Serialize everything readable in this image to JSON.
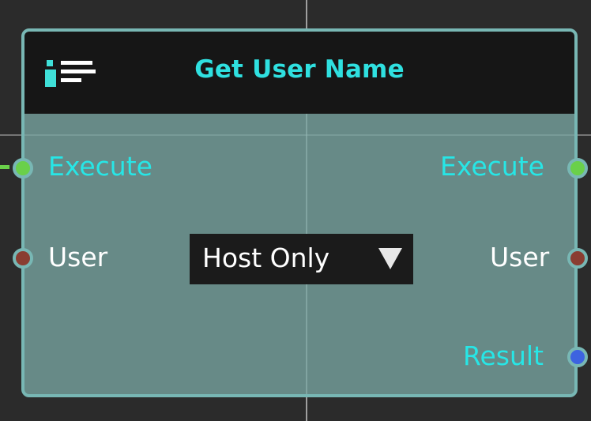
{
  "node": {
    "title": "Get User Name",
    "icon": "user-list-icon"
  },
  "inputs": [
    {
      "label": "Execute",
      "pin_type": "exec"
    },
    {
      "label": "User",
      "pin_type": "user"
    }
  ],
  "outputs": [
    {
      "label": "Execute",
      "pin_type": "exec"
    },
    {
      "label": "User",
      "pin_type": "user"
    },
    {
      "label": "Result",
      "pin_type": "result"
    }
  ],
  "dropdown": {
    "selected": "Host Only",
    "icon": "triangle-down-icon"
  },
  "colors": {
    "title": "#2fe0e0",
    "exec_pin": "#6ad04a",
    "user_pin": "#8a3d31",
    "result_pin": "#3d63e0",
    "node_border": "#78b7b4"
  }
}
